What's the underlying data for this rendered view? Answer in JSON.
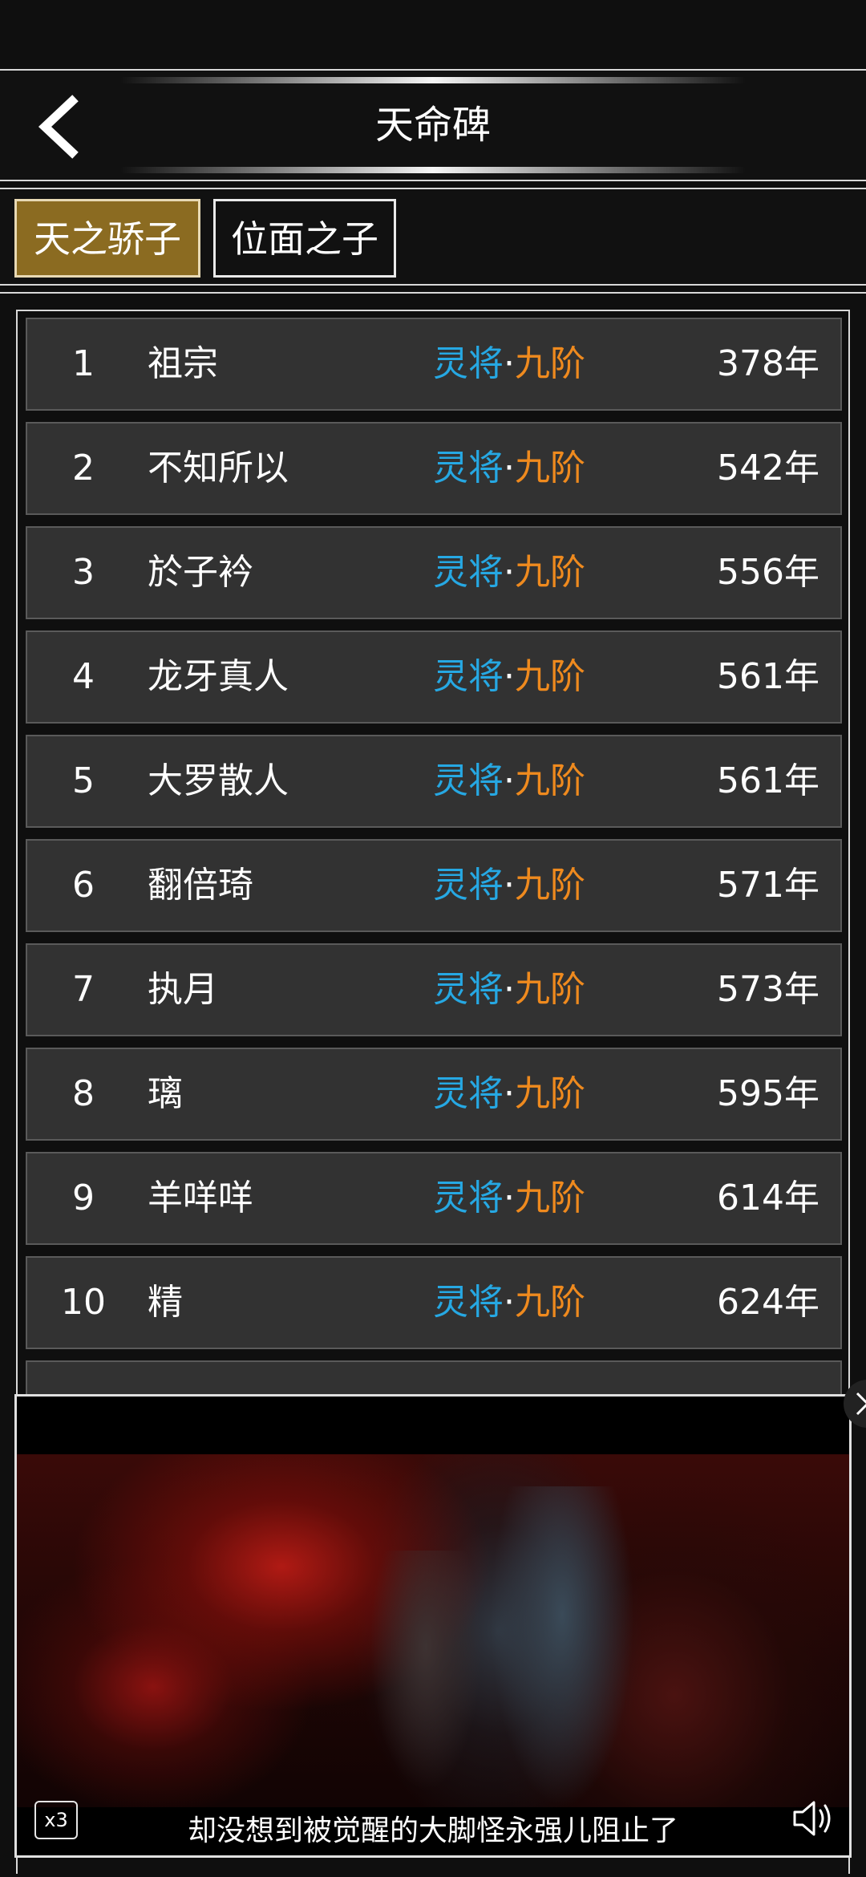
{
  "header": {
    "title": "天命碑",
    "back_icon": "chevron-left-icon"
  },
  "tabs": [
    {
      "label": "天之骄子",
      "active": true
    },
    {
      "label": "位面之子",
      "active": false
    }
  ],
  "rankings": [
    {
      "rank": "1",
      "name": "祖宗",
      "realm": "灵将",
      "stage": "九阶",
      "age": "378年"
    },
    {
      "rank": "2",
      "name": "不知所以",
      "realm": "灵将",
      "stage": "九阶",
      "age": "542年"
    },
    {
      "rank": "3",
      "name": "於子衿",
      "realm": "灵将",
      "stage": "九阶",
      "age": "556年"
    },
    {
      "rank": "4",
      "name": "龙牙真人",
      "realm": "灵将",
      "stage": "九阶",
      "age": "561年"
    },
    {
      "rank": "5",
      "name": "大罗散人",
      "realm": "灵将",
      "stage": "九阶",
      "age": "561年"
    },
    {
      "rank": "6",
      "name": "翻倍琦",
      "realm": "灵将",
      "stage": "九阶",
      "age": "571年"
    },
    {
      "rank": "7",
      "name": "执月",
      "realm": "灵将",
      "stage": "九阶",
      "age": "573年"
    },
    {
      "rank": "8",
      "name": "璃",
      "realm": "灵将",
      "stage": "九阶",
      "age": "595年"
    },
    {
      "rank": "9",
      "name": "羊咩咩",
      "realm": "灵将",
      "stage": "九阶",
      "age": "614年"
    },
    {
      "rank": "10",
      "name": "精",
      "realm": "灵将",
      "stage": "九阶",
      "age": "624年"
    }
  ],
  "realm_separator": "·",
  "colors": {
    "realm": "#26a8e3",
    "stage": "#ef8a1e",
    "active_tab": "#8b6b21"
  },
  "video_ad": {
    "subtitle": "却没想到被觉醒的大脚怪永强儿阻止了",
    "speed_badge": "x3",
    "sound_icon": "speaker-icon",
    "close_icon": "close-icon"
  }
}
